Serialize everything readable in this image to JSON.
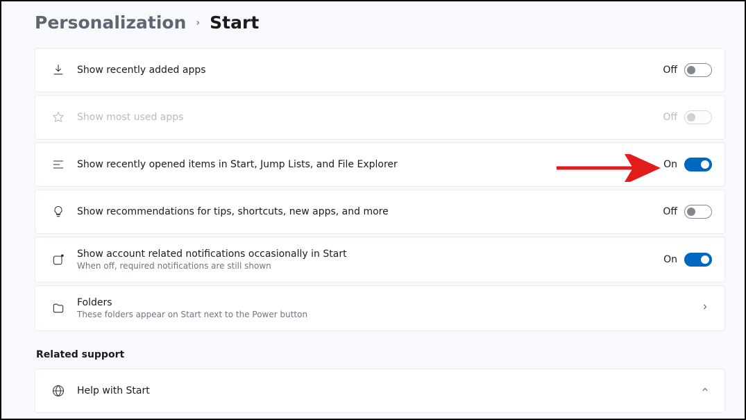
{
  "breadcrumb": {
    "parent": "Personalization",
    "current": "Start"
  },
  "settings": [
    {
      "icon": "download",
      "title": "Show recently added apps",
      "state": "Off",
      "toggle": "off",
      "disabled": false
    },
    {
      "icon": "star",
      "title": "Show most used apps",
      "state": "Off",
      "toggle": "disabled",
      "disabled": true
    },
    {
      "icon": "list",
      "title": "Show recently opened items in Start, Jump Lists, and File Explorer",
      "state": "On",
      "toggle": "on",
      "disabled": false,
      "highlight": true
    },
    {
      "icon": "bulb",
      "title": "Show recommendations for tips, shortcuts, new apps, and more",
      "state": "Off",
      "toggle": "off",
      "disabled": false
    },
    {
      "icon": "bell-square",
      "title": "Show account related notifications occasionally in Start",
      "sub": "When off, required notifications are still shown",
      "state": "On",
      "toggle": "on",
      "disabled": false
    },
    {
      "icon": "folder",
      "title": "Folders",
      "sub": "These folders appear on Start next to the Power button",
      "nav": true,
      "disabled": false
    }
  ],
  "related": {
    "heading": "Related support",
    "help": {
      "title": "Help with Start"
    }
  }
}
